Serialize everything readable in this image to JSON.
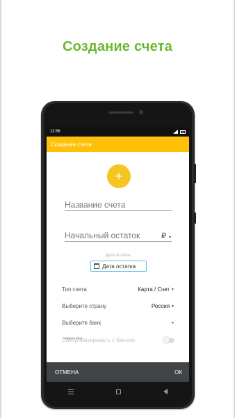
{
  "promo": {
    "title": "Создание счета"
  },
  "status_bar": {
    "time": "11:56"
  },
  "app_bar": {
    "title": "Создание счета"
  },
  "add_button": {
    "symbol": "+"
  },
  "form": {
    "account_name": {
      "placeholder": "Название счета",
      "value": ""
    },
    "initial_balance": {
      "placeholder": "Начальный остаток",
      "value": "",
      "currency": "₽"
    },
    "date_caption": "Дата остатка",
    "date_button_label": "Дата остатка",
    "account_type": {
      "label": "Тип счета",
      "value": "Карта / Счет"
    },
    "country": {
      "label": "Выберите страну",
      "value": "Россия"
    },
    "bank": {
      "label": "Выберите банк",
      "value": ""
    },
    "sync": {
      "label": "Синхронизировать с банком",
      "hint": "Укажите банк",
      "enabled": false
    }
  },
  "actions": {
    "cancel_label": "ОТМЕНА",
    "ok_label": "ОК"
  },
  "colors": {
    "headline": "#6ab82f",
    "app_bar": "#fec008",
    "fab": "#f7c61e",
    "date_button_border": "#55c6e3",
    "action_bar": "#414547"
  },
  "icons": [
    "signal-icon",
    "battery-icon",
    "plus-icon",
    "calendar-icon",
    "chevron-down-icon",
    "menu-icon",
    "home-icon",
    "back-icon"
  ]
}
